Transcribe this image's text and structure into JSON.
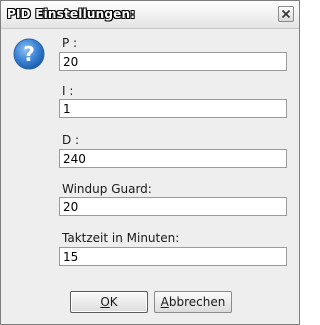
{
  "window": {
    "title": "PID Einstellungen:"
  },
  "icons": {
    "dialog_icon": "question-icon",
    "close_icon": "close-icon"
  },
  "fields": [
    {
      "label": "P :",
      "value": "20"
    },
    {
      "label": "I :",
      "value": "1"
    },
    {
      "label": "D :",
      "value": "240"
    },
    {
      "label": "Windup Guard:",
      "value": "20"
    },
    {
      "label": "Taktzeit in Minuten:",
      "value": "15"
    }
  ],
  "buttons": {
    "ok_mnemonic": "O",
    "ok_rest": "K",
    "cancel_mnemonic": "A",
    "cancel_rest": "bbrechen"
  },
  "colors": {
    "accent": "#3b82d6",
    "window_bg": "#eeeeee"
  }
}
